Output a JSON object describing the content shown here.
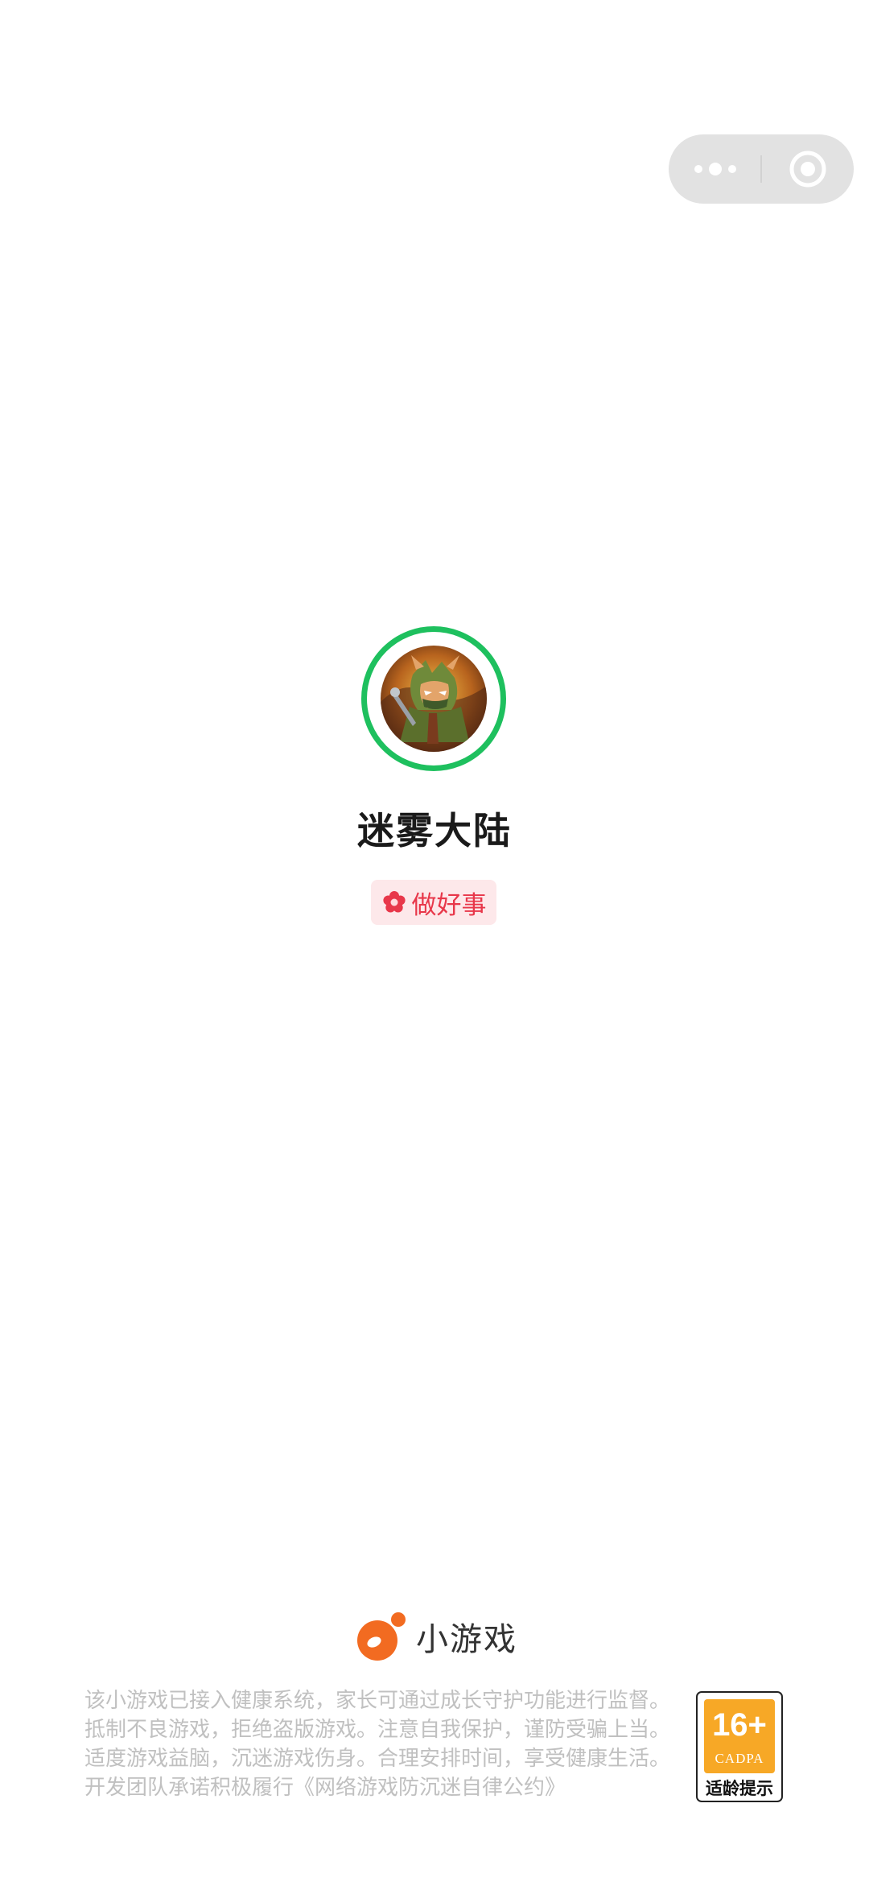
{
  "capsule": {
    "more_icon": "more-dots-icon",
    "close_icon": "exit-circle-icon",
    "color": "#e2e2e2"
  },
  "game": {
    "title": "迷雾大陆",
    "logo_icon": "game-character-logo",
    "ring_color": "#1ec05e"
  },
  "badge": {
    "label": "做好事",
    "icon": "red-flower-icon",
    "color": "#e8374a"
  },
  "brand": {
    "label": "小游戏",
    "icon": "mini-game-logo-icon",
    "color": "#f26b21"
  },
  "notice": {
    "lines": [
      "该小游戏已接入健康系统，家长可通过成长守护功能进行监督。",
      "抵制不良游戏，拒绝盗版游戏。注意自我保护，谨防受骗上当。",
      "适度游戏益脑，沉迷游戏伤身。合理安排时间，享受健康生活。",
      "开发团队承诺积极履行《网络游戏防沉迷自律公约》"
    ]
  },
  "age_rating": {
    "age": "16+",
    "org": "CADPA",
    "hint": "适龄提示",
    "color": "#f7a826"
  }
}
